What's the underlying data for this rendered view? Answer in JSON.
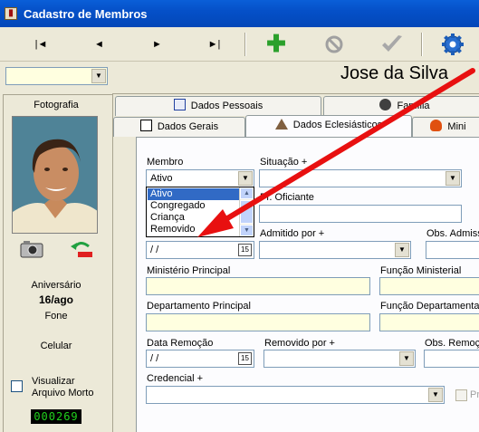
{
  "window": {
    "title": "Cadastro de Membros",
    "icon": "app-book-icon"
  },
  "toolbar": {
    "first_label": "|◄",
    "prev_label": "◄",
    "next_label": "►",
    "last_label": "►|",
    "add_icon": "plus-icon",
    "cancel_icon": "cancel-circle-icon",
    "confirm_icon": "checkmark-icon",
    "settings_icon": "gear-icon",
    "colors": {
      "add": "#2ba02b",
      "cancel": "#a0a0a0",
      "confirm": "#a0a0a0",
      "settings": "#1c5db8"
    }
  },
  "search": {
    "value": ""
  },
  "person": {
    "name": "Jose da Silva"
  },
  "left": {
    "photo_label": "Fotografia",
    "birthday_label": "Aniversário",
    "birthday_value": "16/ago",
    "phone_label": "Fone",
    "mobile_label": "Celular",
    "archive_label_1": "Visualizar",
    "archive_label_2": "Arquivo Morto",
    "counter": "000269"
  },
  "tabs_row1": [
    "Dados Pessoais",
    "Família"
  ],
  "tabs_row2": [
    "Dados Gerais",
    "Dados Eclesiásticos",
    "Mini"
  ],
  "form": {
    "membro_label": "Membro",
    "membro_value": "Ativo",
    "membro_options": [
      "Ativo",
      "Congregado",
      "Criança",
      "Removido"
    ],
    "situacao_label": "Situação +",
    "pr_oficiante_label": "Pr. Oficiante",
    "admitido_por_label": "Admitido por +",
    "obs_admissao_label": "Obs. Admiss",
    "data_admissao_value": " /  /",
    "ministerio_label": "Ministério Principal",
    "funcao_ministerial_label": "Função Ministerial",
    "departamento_label": "Departamento Principal",
    "funcao_departamental_label": "Função Departamental",
    "data_remocao_label": "Data Remoção",
    "data_remocao_value": " /  /",
    "removido_por_label": "Removido por +",
    "obs_remocao_label": "Obs. Remoç",
    "credencial_label": "Credencial +",
    "pr_checkbox_label": "Pr"
  },
  "annotation": {
    "color": "#e81010"
  }
}
